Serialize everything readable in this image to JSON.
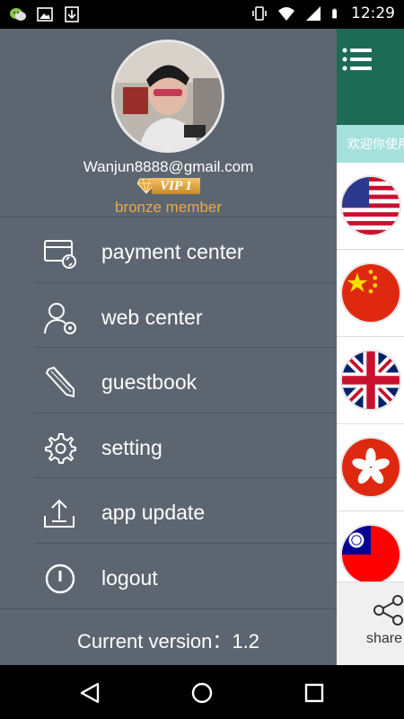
{
  "status_bar": {
    "time": "12:29",
    "notification_icons": [
      "wechat-icon",
      "image-icon",
      "download-icon"
    ],
    "system_icons": [
      "vibrate-icon",
      "wifi-icon",
      "signal-icon",
      "battery-icon"
    ]
  },
  "drawer": {
    "email": "Wanjun8888@gmail.com",
    "vip_badge": "VIP 1",
    "member_level": "bronze member",
    "menu": [
      {
        "label": "payment center",
        "icon": "card-refresh-icon"
      },
      {
        "label": "web center",
        "icon": "user-gear-icon"
      },
      {
        "label": "guestbook",
        "icon": "pencil-icon"
      },
      {
        "label": "setting",
        "icon": "gear-icon"
      },
      {
        "label": "app update",
        "icon": "upload-icon"
      },
      {
        "label": "logout",
        "icon": "power-icon"
      }
    ],
    "version": "Current version：1.2"
  },
  "background_app": {
    "welcome_text": "欢迎你使用",
    "flags": [
      "usa-flag-icon",
      "china-flag-icon",
      "uk-flag-icon",
      "hong-kong-flag-icon",
      "taiwan-flag-icon"
    ],
    "share_label": "share",
    "colors": {
      "topbar": "#1d6a55",
      "welcome": "#a6e0dd"
    }
  },
  "colors": {
    "drawer_bg": "#5d6670",
    "member_text": "#e9a74a",
    "vip_gold": "#d99a35"
  }
}
